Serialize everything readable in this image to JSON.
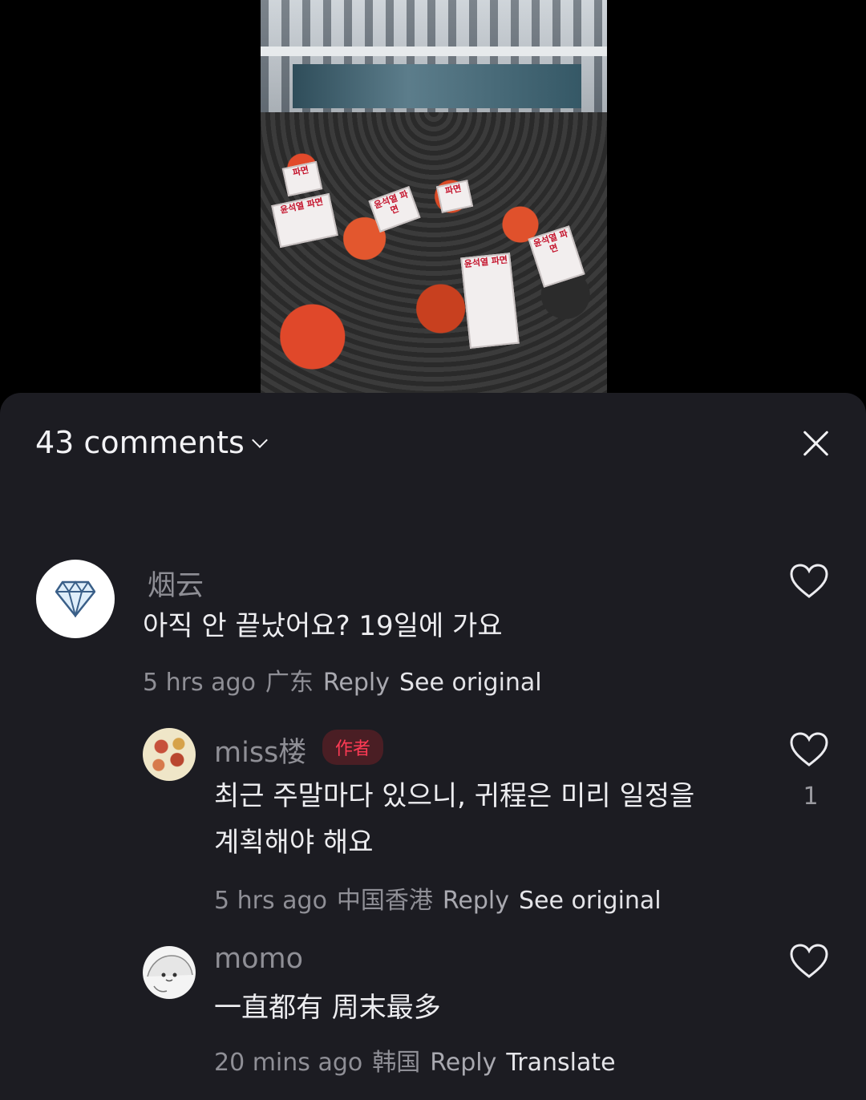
{
  "video": {
    "placards": [
      "윤석열 파면",
      "윤석열 파면",
      "윤석열 파면",
      "윤석열 파면",
      "파면",
      "파면"
    ]
  },
  "header": {
    "count_label": "43 comments"
  },
  "comments": [
    {
      "username": "烟云",
      "text": "아직 안 끝났어요? 19일에 가요",
      "time": "5 hrs ago",
      "location": "广东",
      "reply_label": "Reply",
      "action_label": "See original",
      "avatar_icon": "diamond-icon"
    },
    {
      "username": "miss楼",
      "badge": "作者",
      "text_line1": "최근 주말마다 있으니, 귀程은 미리 일정을",
      "text_line2": "계획해야 해요",
      "time": "5 hrs ago",
      "location": "中国香港",
      "reply_label": "Reply",
      "action_label": "See original",
      "likes": "1"
    },
    {
      "username": "momo",
      "text": "一直都有 周末最多",
      "time": "20 mins ago",
      "location": "韩国",
      "reply_label": "Reply",
      "action_label": "Translate"
    }
  ],
  "colors": {
    "sheet_bg": "#1c1c22",
    "badge_text": "#ff3b55",
    "muted": "#8f8f96"
  }
}
